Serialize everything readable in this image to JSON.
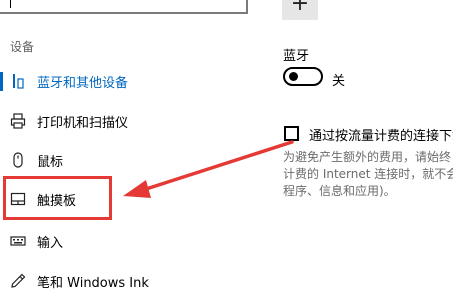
{
  "sidebar": {
    "section_title": "设备",
    "items": [
      {
        "label": "蓝牙和其他设备",
        "icon": "bluetooth-devices-icon",
        "active": true
      },
      {
        "label": "打印机和扫描仪",
        "icon": "printer-icon",
        "active": false
      },
      {
        "label": "鼠标",
        "icon": "mouse-icon",
        "active": false
      },
      {
        "label": "触摸板",
        "icon": "touchpad-icon",
        "active": false
      },
      {
        "label": "输入",
        "icon": "keyboard-icon",
        "active": false
      },
      {
        "label": "笔和 Windows Ink",
        "icon": "pen-icon",
        "active": false
      }
    ]
  },
  "top": {
    "add_symbol": "+"
  },
  "bluetooth": {
    "heading": "蓝牙",
    "toggle_state": "关"
  },
  "metered": {
    "checkbox_label": "通过按流量计费的连接下载",
    "description_lines": [
      "为避免产生额外的费用，请始终",
      "计费的 Internet 连接时，就不会",
      "程序、信息和应用)。"
    ]
  },
  "colors": {
    "accent": "#0067c0",
    "annotation": "#e53935"
  }
}
